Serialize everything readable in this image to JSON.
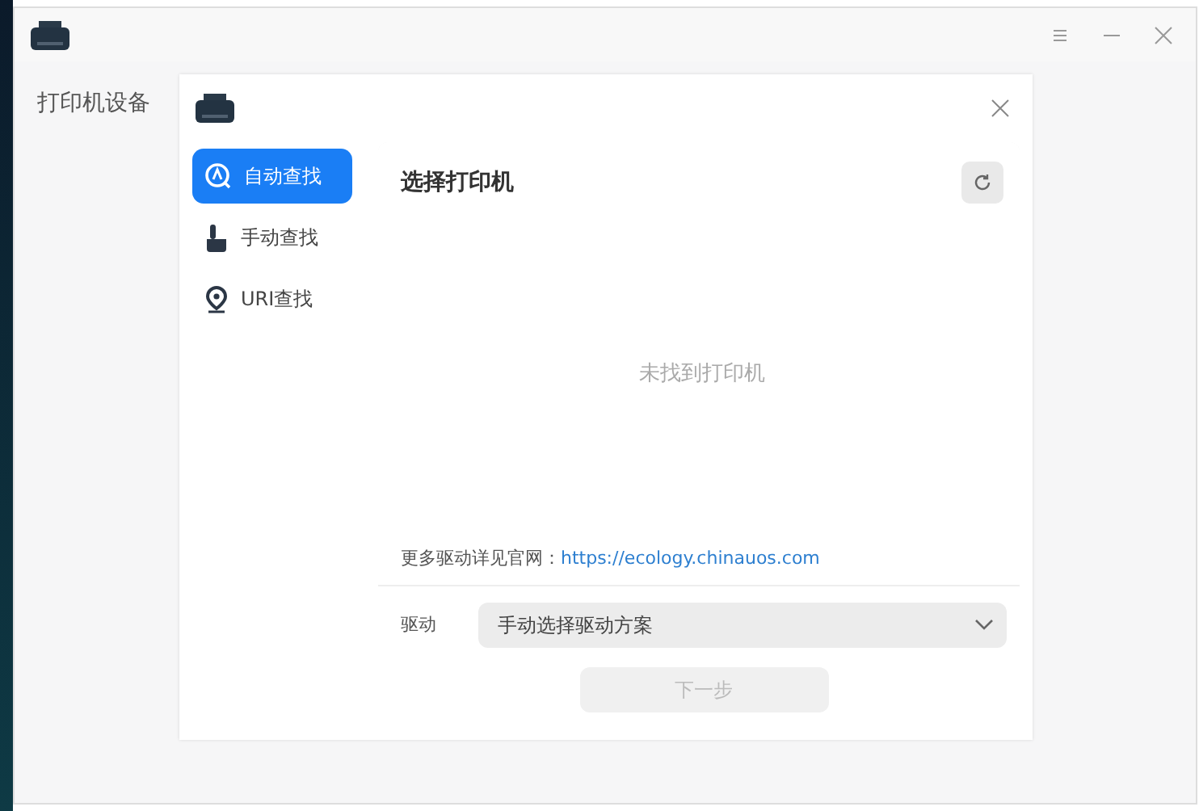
{
  "window": {
    "sidebar_title": "打印机设备"
  },
  "dialog": {
    "nav_items": [
      {
        "label": "自动查找",
        "kind": "auto",
        "selected": true
      },
      {
        "label": "手动查找",
        "kind": "manual",
        "selected": false
      },
      {
        "label": "URI查找",
        "kind": "uri",
        "selected": false
      }
    ],
    "panel_title": "选择打印机",
    "empty_message": "未找到打印机",
    "more_drivers_text": "更多驱动详见官网：",
    "more_drivers_link": "https://ecology.chinauos.com",
    "driver_label": "驱动",
    "driver_select": {
      "value": "手动选择驱动方案"
    },
    "next_button": {
      "label": "下一步",
      "disabled": true
    }
  }
}
